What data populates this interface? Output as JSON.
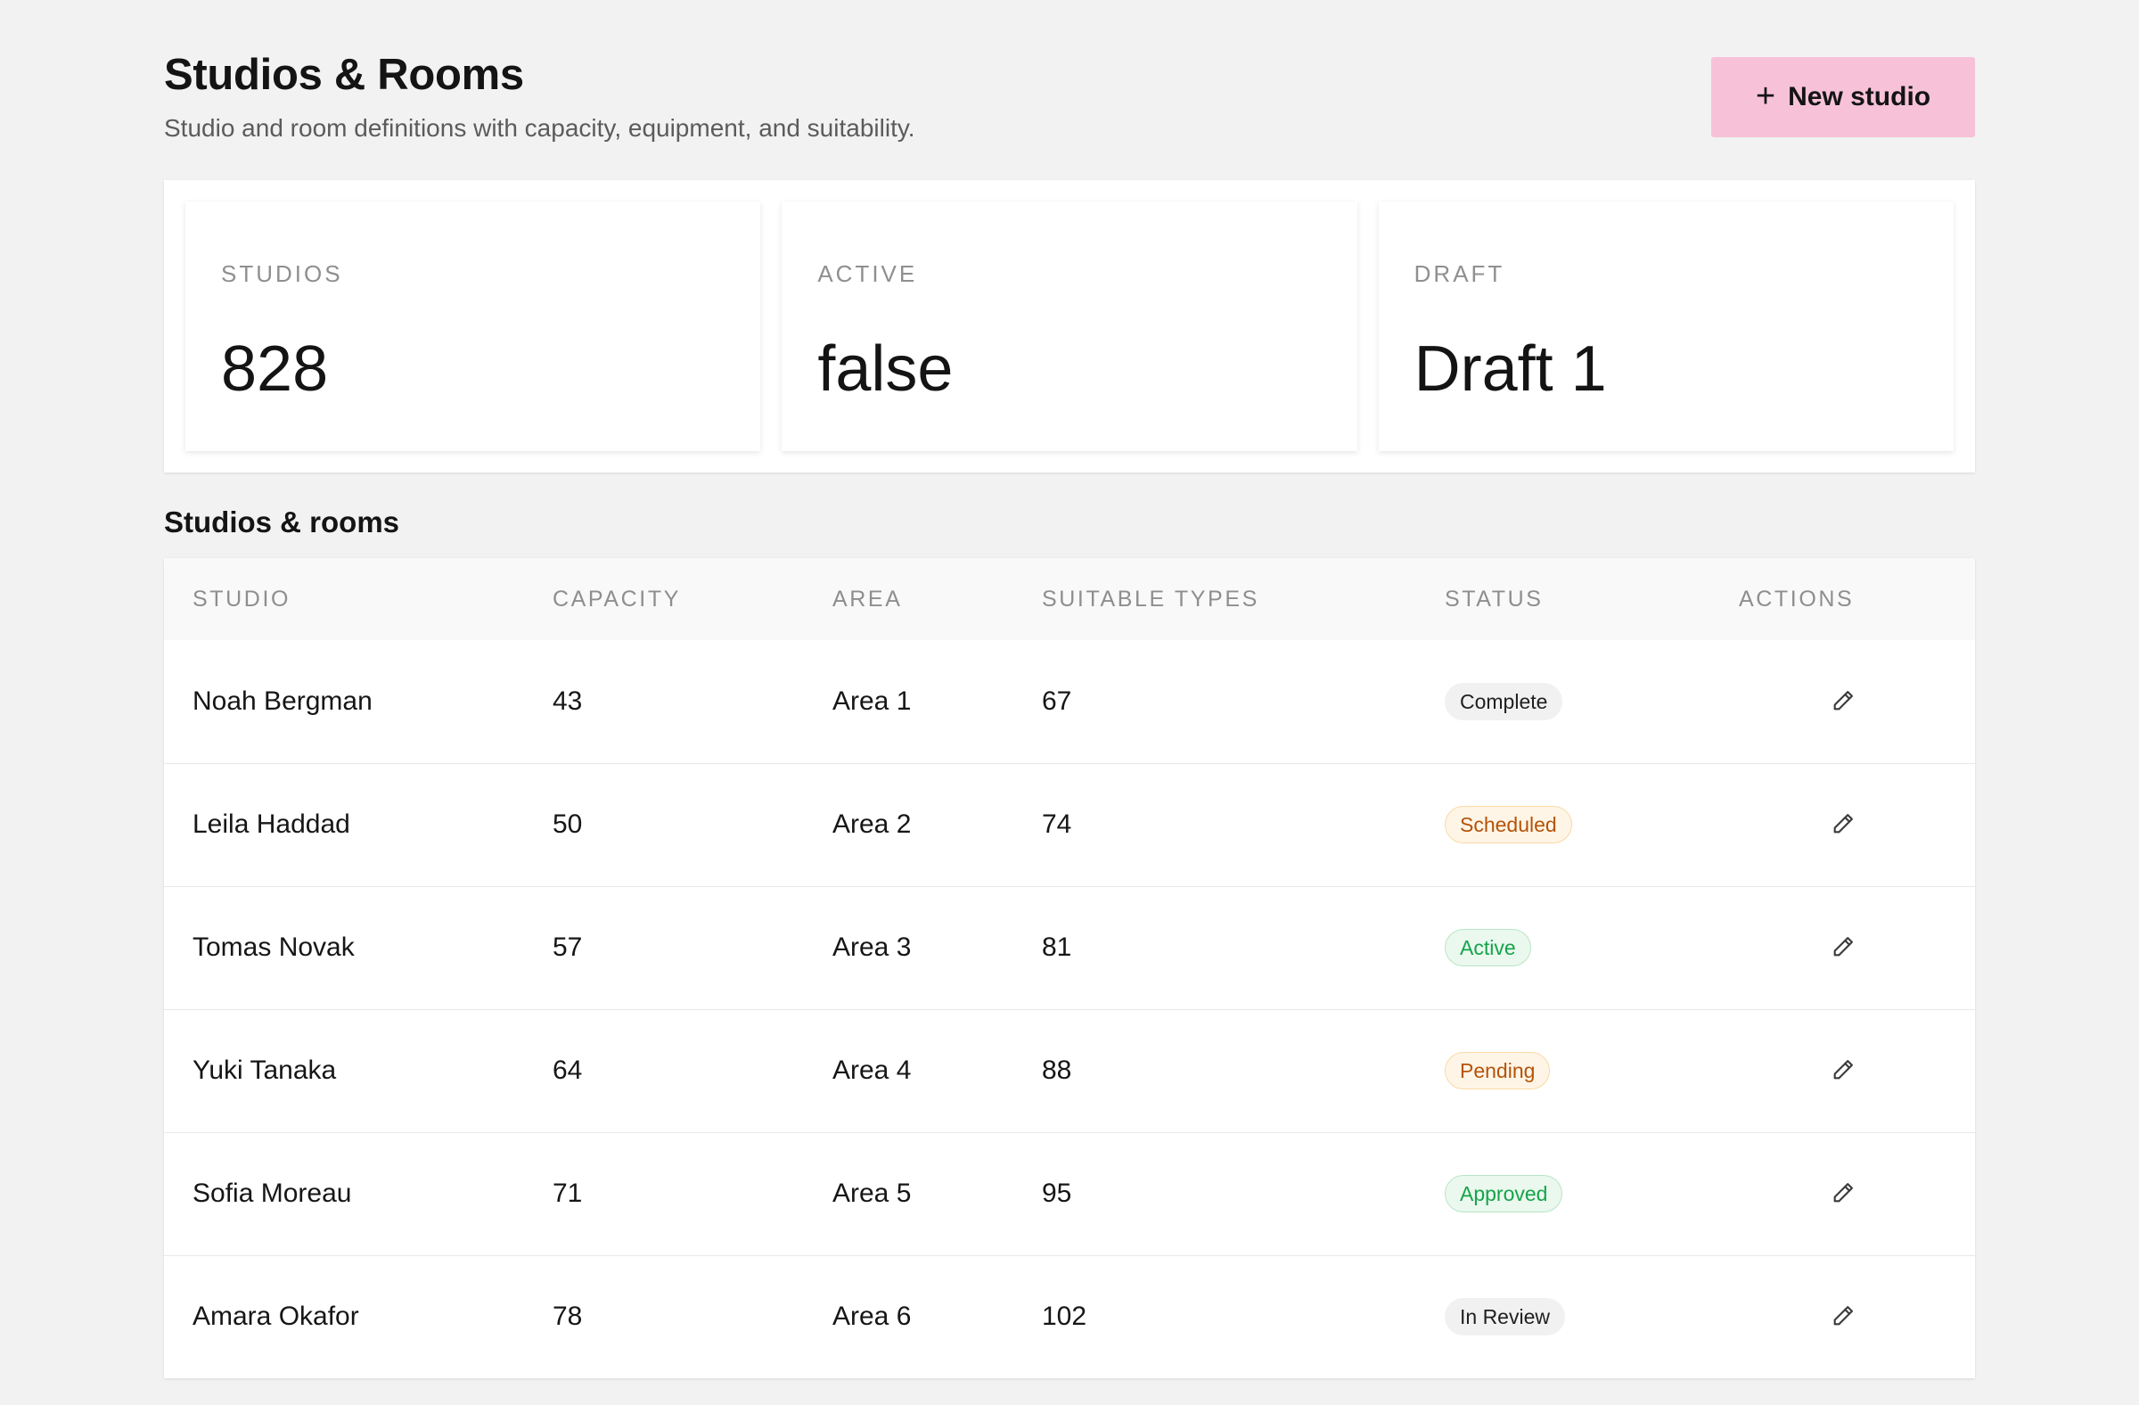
{
  "header": {
    "title": "Studios & Rooms",
    "subtitle": "Studio and room definitions with capacity, equipment, and suitability.",
    "new_button": {
      "label": "New studio",
      "icon": "plus-icon"
    }
  },
  "stats": [
    {
      "label": "STUDIOS",
      "value": "828"
    },
    {
      "label": "ACTIVE",
      "value": "false"
    },
    {
      "label": "DRAFT",
      "value": "Draft 1"
    }
  ],
  "section": {
    "title": "Studios & rooms"
  },
  "table": {
    "columns": [
      "STUDIO",
      "CAPACITY",
      "AREA",
      "SUITABLE TYPES",
      "STATUS",
      "ACTIONS"
    ],
    "rows": [
      {
        "studio": "Noah Bergman",
        "capacity": "43",
        "area": "Area 1",
        "types": "67",
        "status": "Complete",
        "status_tone": "neutral"
      },
      {
        "studio": "Leila Haddad",
        "capacity": "50",
        "area": "Area 2",
        "types": "74",
        "status": "Scheduled",
        "status_tone": "amber"
      },
      {
        "studio": "Tomas Novak",
        "capacity": "57",
        "area": "Area 3",
        "types": "81",
        "status": "Active",
        "status_tone": "green"
      },
      {
        "studio": "Yuki Tanaka",
        "capacity": "64",
        "area": "Area 4",
        "types": "88",
        "status": "Pending",
        "status_tone": "amber"
      },
      {
        "studio": "Sofia Moreau",
        "capacity": "71",
        "area": "Area 5",
        "types": "95",
        "status": "Approved",
        "status_tone": "green"
      },
      {
        "studio": "Amara Okafor",
        "capacity": "78",
        "area": "Area 6",
        "types": "102",
        "status": "In Review",
        "status_tone": "neutral"
      }
    ],
    "row_action_icon": "pencil-icon"
  },
  "colors": {
    "background": "#f2f2f2",
    "accent_button": "#f7c2d8",
    "badge_amber_text": "#b45309",
    "badge_green_text": "#16a34a"
  }
}
